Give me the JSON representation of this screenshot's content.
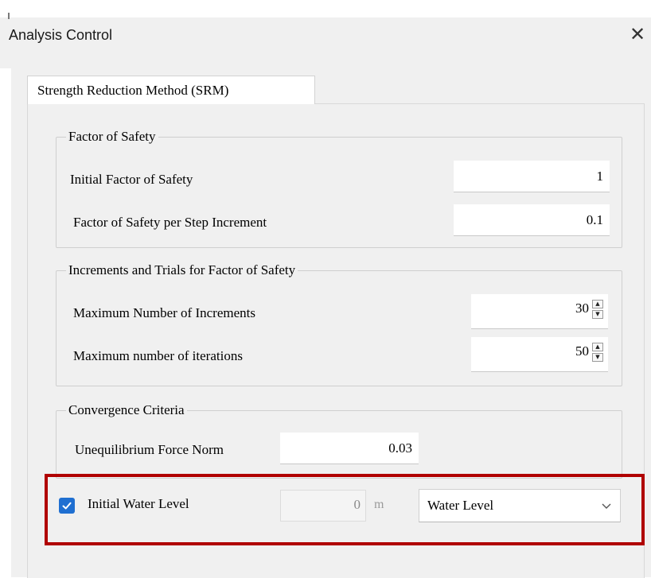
{
  "window": {
    "title": "Analysis Control",
    "close_glyph": "✕"
  },
  "tabs": [
    {
      "label": "Strength Reduction Method (SRM)",
      "active": true
    }
  ],
  "factor_of_safety": {
    "legend": "Factor of Safety",
    "initial_label": "Initial Factor of Safety",
    "initial_value": "1",
    "step_label": "Factor of Safety per Step Increment",
    "step_value": "0.1"
  },
  "increments": {
    "legend": "Increments and Trials for Factor of Safety",
    "max_increments_label": "Maximum Number of Increments",
    "max_increments_value": "30",
    "max_iterations_label": "Maximum number of iterations",
    "max_iterations_value": "50"
  },
  "convergence": {
    "legend": "Convergence Criteria",
    "force_norm_label": "Unequilibrium Force Norm",
    "force_norm_value": "0.03"
  },
  "water_level": {
    "checked": true,
    "label": "Initial Water Level",
    "value": "0",
    "unit": "m",
    "selected_option": "Water Level"
  },
  "colors": {
    "highlight": "#b00000",
    "checkbox": "#1f6fd1"
  },
  "icons": {
    "close": "close-icon",
    "spin_up": "spin-up-icon",
    "spin_down": "spin-down-icon",
    "dropdown": "chevron-down-icon",
    "check": "checkmark-icon"
  }
}
